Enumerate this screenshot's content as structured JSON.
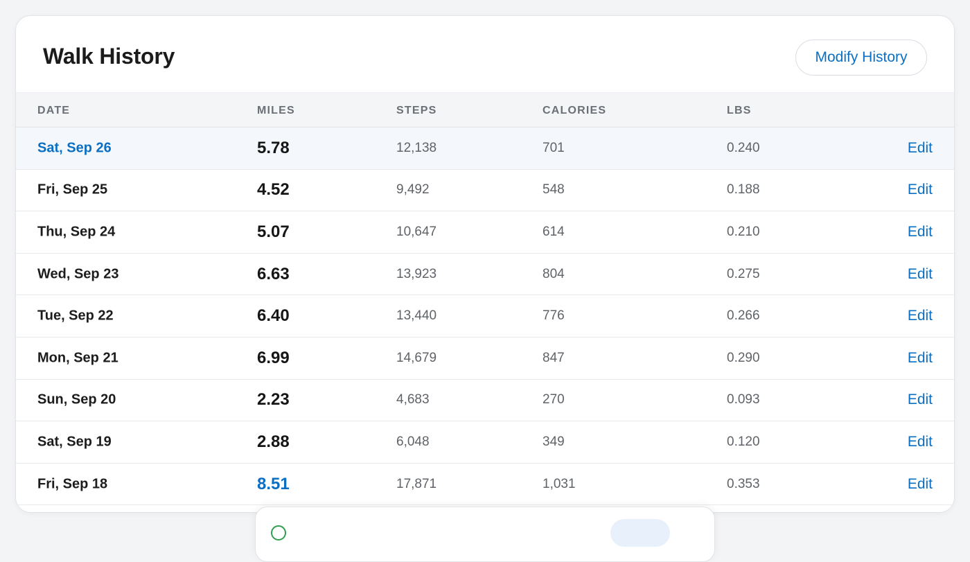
{
  "card": {
    "title": "Walk History",
    "modify_label": "Modify History"
  },
  "table": {
    "headers": {
      "date": "DATE",
      "miles": "MILES",
      "steps": "STEPS",
      "calories": "CALORIES",
      "lbs": "LBS"
    },
    "edit_label": "Edit",
    "rows": [
      {
        "date": "Sat, Sep 26",
        "miles": "5.78",
        "steps": "12,138",
        "calories": "701",
        "lbs": "0.240",
        "edit": "Edit"
      },
      {
        "date": "Fri, Sep 25",
        "miles": "4.52",
        "steps": "9,492",
        "calories": "548",
        "lbs": "0.188",
        "edit": "Edit"
      },
      {
        "date": "Thu, Sep 24",
        "miles": "5.07",
        "steps": "10,647",
        "calories": "614",
        "lbs": "0.210",
        "edit": "Edit"
      },
      {
        "date": "Wed, Sep 23",
        "miles": "6.63",
        "steps": "13,923",
        "calories": "804",
        "lbs": "0.275",
        "edit": "Edit"
      },
      {
        "date": "Tue, Sep 22",
        "miles": "6.40",
        "steps": "13,440",
        "calories": "776",
        "lbs": "0.266",
        "edit": "Edit"
      },
      {
        "date": "Mon, Sep 21",
        "miles": "6.99",
        "steps": "14,679",
        "calories": "847",
        "lbs": "0.290",
        "edit": "Edit"
      },
      {
        "date": "Sun, Sep 20",
        "miles": "2.23",
        "steps": "4,683",
        "calories": "270",
        "lbs": "0.093",
        "edit": "Edit"
      },
      {
        "date": "Sat, Sep 19",
        "miles": "2.88",
        "steps": "6,048",
        "calories": "349",
        "lbs": "0.120",
        "edit": "Edit"
      },
      {
        "date": "Fri, Sep 18",
        "miles": "8.51",
        "steps": "17,871",
        "calories": "1,031",
        "lbs": "0.353",
        "edit": "Edit"
      }
    ]
  },
  "toast": {
    "icon": "check-circle-icon",
    "text": "",
    "action_label": ""
  },
  "colors": {
    "accent": "#0a6fc2",
    "highlight_row": "#f4f8fc",
    "success": "#2e9e4f"
  }
}
